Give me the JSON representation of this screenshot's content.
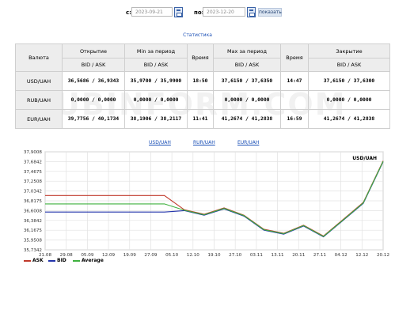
{
  "filter": {
    "from_label": "с:",
    "from_value": "2023-09-21",
    "to_label": "по:",
    "to_value": "2023-12-20",
    "show_button": "показать"
  },
  "stats_link": "Статистика",
  "table": {
    "headers": {
      "currency": "Валюта",
      "open": "Открытие",
      "min": "Min за период",
      "time1": "Время",
      "max": "Max за период",
      "time2": "Время",
      "close": "Закрытие",
      "bidask": "BID / ASK"
    },
    "rows": [
      {
        "currency": "USD/UAH",
        "open": "36,5686 / 36,9343",
        "min": "35,9700 / 35,9900",
        "min_time": "18:50",
        "max": "37,6150 / 37,6350",
        "max_time": "14:47",
        "close": "37,6150 / 37,6300"
      },
      {
        "currency": "RUB/UAH",
        "open": "0,0000 / 0,0000",
        "min": "0,0000 / 0,0000",
        "min_time": "",
        "max": "0,0000 / 0,0000",
        "max_time": "",
        "close": "0,0000 / 0,0000"
      },
      {
        "currency": "EUR/UAH",
        "open": "39,7756 / 40,1734",
        "min": "38,1906 / 38,2117",
        "min_time": "11:41",
        "max": "41,2674 / 41,2838",
        "max_time": "16:59",
        "close": "41,2674 / 41,2838"
      }
    ]
  },
  "watermark": "UBINFORM.COM",
  "chart_tabs": [
    "USD/UAH",
    "RUR/UAH",
    "EUR/UAH"
  ],
  "chart_data": {
    "type": "line",
    "title": "USD/UAH",
    "x": [
      "21.08",
      "29.08",
      "05.09",
      "13.09",
      "20.09",
      "27.09",
      "05.10",
      "12.10",
      "19.10",
      "27.10",
      "03.11",
      "10.11",
      "17.11",
      "24.11",
      "01.12",
      "08.12",
      "15.12",
      "20.12"
    ],
    "x_ticks": [
      "21.08",
      "29.08",
      "05.09",
      "12.09",
      "19.09",
      "27.09",
      "05.10",
      "12.10",
      "19.10",
      "27.10",
      "03.11",
      "13.11",
      "20.11",
      "27.11",
      "04.12",
      "12.12",
      "20.12"
    ],
    "y_ticks": [
      "37,9008",
      "37,6842",
      "37,4675",
      "37,2508",
      "37,0342",
      "36,8175",
      "36,6008",
      "36,3842",
      "36,1675",
      "35,9508",
      "35,7342"
    ],
    "ylim": [
      35.7342,
      37.9008
    ],
    "grid": true,
    "series": [
      {
        "name": "ASK",
        "color": "#c0392b",
        "values": [
          36.934,
          36.934,
          36.934,
          36.934,
          36.934,
          36.934,
          36.934,
          36.62,
          36.52,
          36.66,
          36.5,
          36.19,
          36.1,
          36.28,
          36.04,
          36.41,
          36.78,
          37.7
        ]
      },
      {
        "name": "BID",
        "color": "#2233aa",
        "values": [
          36.569,
          36.569,
          36.569,
          36.569,
          36.569,
          36.569,
          36.569,
          36.6,
          36.5,
          36.64,
          36.48,
          36.17,
          36.08,
          36.26,
          36.02,
          36.39,
          36.76,
          37.68
        ]
      },
      {
        "name": "Average",
        "color": "#3fb13f",
        "values": [
          36.75,
          36.75,
          36.75,
          36.75,
          36.75,
          36.75,
          36.75,
          36.61,
          36.51,
          36.65,
          36.49,
          36.18,
          36.09,
          36.27,
          36.03,
          36.4,
          36.77,
          37.69
        ]
      }
    ]
  }
}
